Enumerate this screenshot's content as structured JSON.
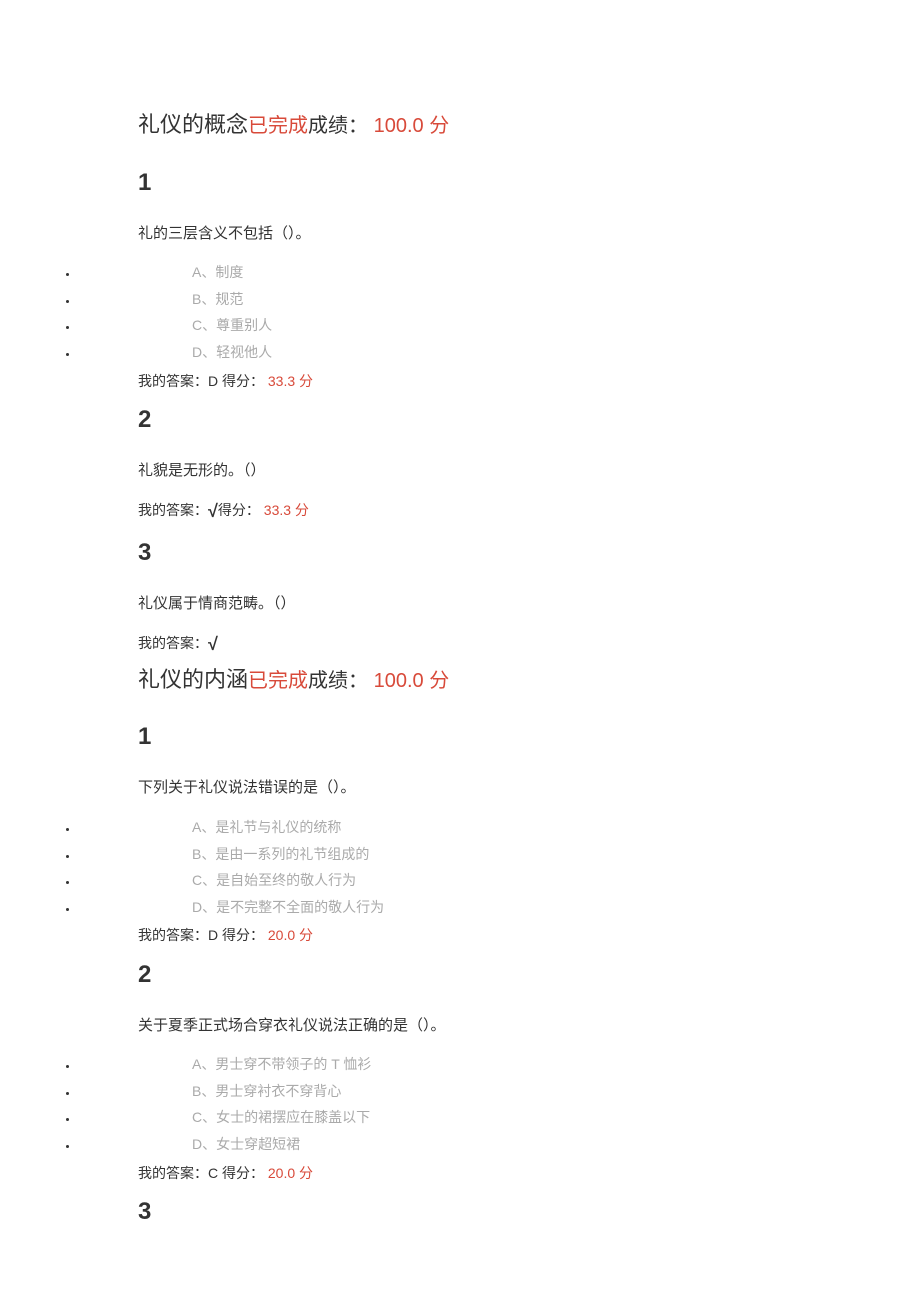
{
  "sections": [
    {
      "title": "礼仪的概念",
      "status": "已完成",
      "score_label": "成绩：",
      "score_val": " 100.0 ",
      "score_unit": "分",
      "questions": [
        {
          "num": "1",
          "text": "礼的三层含义不包括（）。",
          "options": [
            {
              "letter": "A、",
              "text": "制度"
            },
            {
              "letter": "B、",
              "text": "规范"
            },
            {
              "letter": "C、",
              "text": "尊重别人"
            },
            {
              "letter": "D、",
              "text": "轻视他人"
            }
          ],
          "answer_label": "我的答案：",
          "answer_val": "D ",
          "answer_check": "",
          "pts_label": "得分：",
          "pts_val": " 33.3 ",
          "pts_unit": "分"
        },
        {
          "num": "2",
          "text": "礼貌是无形的。（）",
          "options": [],
          "answer_label": "我的答案：",
          "answer_val": "",
          "answer_check": "√",
          "pts_label": "得分：",
          "pts_val": " 33.3 ",
          "pts_unit": "分"
        },
        {
          "num": "3",
          "text": "礼仪属于情商范畴。（）",
          "options": [],
          "answer_label": "我的答案：",
          "answer_val": "",
          "answer_check": "√",
          "pts_label": "",
          "pts_val": "",
          "pts_unit": ""
        }
      ]
    },
    {
      "title": "礼仪的内涵",
      "status": "已完成",
      "score_label": "成绩：",
      "score_val": " 100.0 ",
      "score_unit": "分",
      "questions": [
        {
          "num": "1",
          "text": "下列关于礼仪说法错误的是（）。",
          "options": [
            {
              "letter": "A、",
              "text": "是礼节与礼仪的统称"
            },
            {
              "letter": "B、",
              "text": "是由一系列的礼节组成的"
            },
            {
              "letter": "C、",
              "text": "是自始至终的敬人行为"
            },
            {
              "letter": "D、",
              "text": "是不完整不全面的敬人行为"
            }
          ],
          "answer_label": "我的答案：",
          "answer_val": "D ",
          "answer_check": "",
          "pts_label": "得分：",
          "pts_val": " 20.0 ",
          "pts_unit": "分"
        },
        {
          "num": "2",
          "text": "关于夏季正式场合穿衣礼仪说法正确的是（）。",
          "options": [
            {
              "letter": "A、",
              "text": "男士穿不带领子的 T 恤衫"
            },
            {
              "letter": "B、",
              "text": "男士穿衬衣不穿背心"
            },
            {
              "letter": "C、",
              "text": "女士的裙摆应在膝盖以下"
            },
            {
              "letter": "D、",
              "text": "女士穿超短裙"
            }
          ],
          "answer_label": "我的答案：",
          "answer_val": "C ",
          "answer_check": "",
          "pts_label": "得分：",
          "pts_val": " 20.0 ",
          "pts_unit": "分"
        },
        {
          "num": "3",
          "text": "",
          "options": [],
          "answer_label": "",
          "answer_val": "",
          "answer_check": "",
          "pts_label": "",
          "pts_val": "",
          "pts_unit": ""
        }
      ]
    }
  ]
}
